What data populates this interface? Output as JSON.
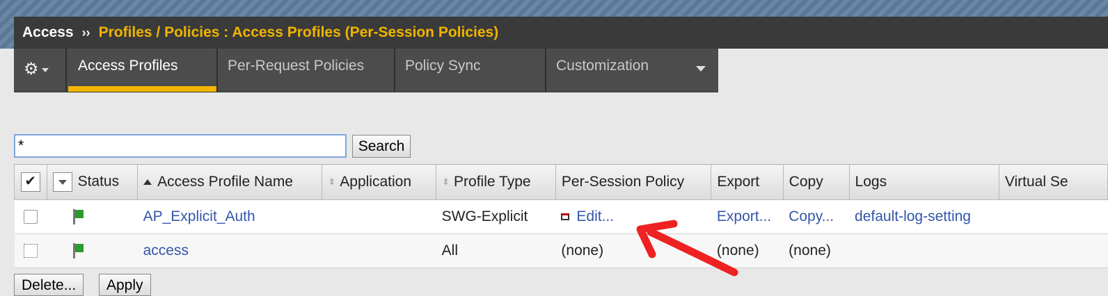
{
  "breadcrumb": {
    "root": "Access",
    "separator": "››",
    "path": "Profiles / Policies : Access Profiles (Per-Session Policies)"
  },
  "tabs": [
    {
      "label": "Access Profiles",
      "active": true
    },
    {
      "label": "Per-Request Policies",
      "active": false
    },
    {
      "label": "Policy Sync",
      "active": false
    },
    {
      "label": "Customization",
      "active": false,
      "has_dropdown": true
    }
  ],
  "gear_menu": {
    "icon": "gear-icon"
  },
  "search": {
    "value": "*",
    "button_label": "Search"
  },
  "table": {
    "headers": {
      "status": "Status",
      "name": "Access Profile Name",
      "application": "Application",
      "profile_type": "Profile Type",
      "per_session_policy": "Per-Session Policy",
      "export": "Export",
      "copy": "Copy",
      "logs": "Logs",
      "virtual_servers": "Virtual Se"
    },
    "rows": [
      {
        "name": "AP_Explicit_Auth",
        "application": "",
        "profile_type": "SWG-Explicit",
        "per_session_policy": "Edit...",
        "export": "Export...",
        "copy": "Copy...",
        "logs": "default-log-setting",
        "virtual_servers": ""
      },
      {
        "name": "access",
        "application": "",
        "profile_type": "All",
        "per_session_policy": "(none)",
        "export": "(none)",
        "copy": "(none)",
        "logs": "",
        "virtual_servers": ""
      }
    ]
  },
  "actions": {
    "delete_label": "Delete...",
    "apply_label": "Apply"
  },
  "colors": {
    "accent": "#f2b600",
    "breadcrumb_path": "#f0b400",
    "link": "#3355aa",
    "annotation_arrow": "#ee2222",
    "status_green": "#2e9a2e"
  }
}
